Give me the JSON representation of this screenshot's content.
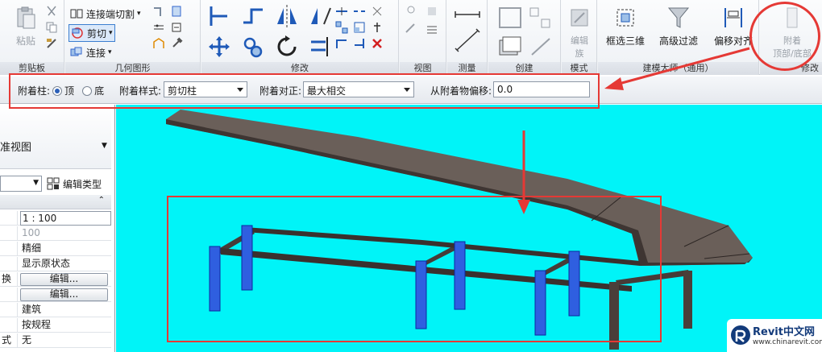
{
  "ribbon": {
    "clipboard": {
      "paste_label": "粘贴",
      "title": "剪贴板"
    },
    "geometry": {
      "join_cut_label": "连接端切割",
      "cut_label": "剪切",
      "join_label": "连接",
      "title": "几何图形"
    },
    "modify": {
      "title": "修改"
    },
    "view": {
      "title": "视图"
    },
    "measure": {
      "title": "测量"
    },
    "create": {
      "title": "创建"
    },
    "mode": {
      "edit_family_label": "编辑\n族",
      "title": "模式"
    },
    "model_tools": {
      "box_3d_label": "框选三维",
      "advanced_filter_label": "高级过滤",
      "offset_align_label": "偏移对齐",
      "title": "建模大师（通用）"
    },
    "modify_column": {
      "attach_label_1": "附着",
      "attach_label_2": "顶部/底部",
      "title": "修改"
    }
  },
  "optbar": {
    "attach_column_label": "附着柱:",
    "top_label": "顶",
    "bottom_label": "底",
    "attach_style_label": "附着样式:",
    "attach_style_value": "剪切柱",
    "attach_justify_label": "附着对正:",
    "attach_justify_value": "最大相交",
    "offset_label": "从附着物偏移:",
    "offset_value": "0.0"
  },
  "props": {
    "type_view": "准视图",
    "edit_type_label": "编辑类型",
    "rows": [
      {
        "key": "",
        "value": "1 : 100"
      },
      {
        "key": "",
        "value": "100"
      },
      {
        "key": "",
        "value": "精细"
      },
      {
        "key": "",
        "value": "显示原状态"
      },
      {
        "key": "换",
        "value": "编辑..."
      },
      {
        "key": "",
        "value": "编辑..."
      },
      {
        "key": "",
        "value": "建筑"
      },
      {
        "key": "",
        "value": "按规程"
      },
      {
        "key": "式",
        "value": "无"
      }
    ]
  },
  "watermark": {
    "brand": "Revit中文网",
    "url": "www.chinarevit.com"
  },
  "colors": {
    "viewport_bg": "#00f4f8",
    "highlight_red": "#e53935",
    "column_blue": "#2f5fe0",
    "beam_dark": "#4a3f3a"
  }
}
